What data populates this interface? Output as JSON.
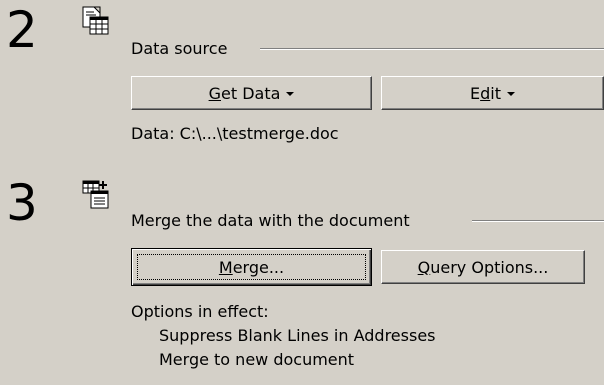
{
  "step2": {
    "number": "2",
    "section_title": "Data source",
    "get_data_label": {
      "pre": "",
      "mnemonic": "G",
      "post": "et Data"
    },
    "edit_label": {
      "pre": "E",
      "mnemonic": "d",
      "post": "it"
    },
    "data_path": "Data: C:\\...\\testmerge.doc",
    "icon": "data-source-icon"
  },
  "step3": {
    "number": "3",
    "section_title": "Merge the data with the document",
    "merge_label": {
      "pre": "",
      "mnemonic": "M",
      "post": "erge..."
    },
    "query_label": {
      "pre": "",
      "mnemonic": "Q",
      "post": "uery Options..."
    },
    "options_heading": "Options in effect:",
    "options": [
      "Suppress Blank Lines in Addresses",
      "Merge to new document"
    ],
    "icon": "merge-data-icon"
  }
}
